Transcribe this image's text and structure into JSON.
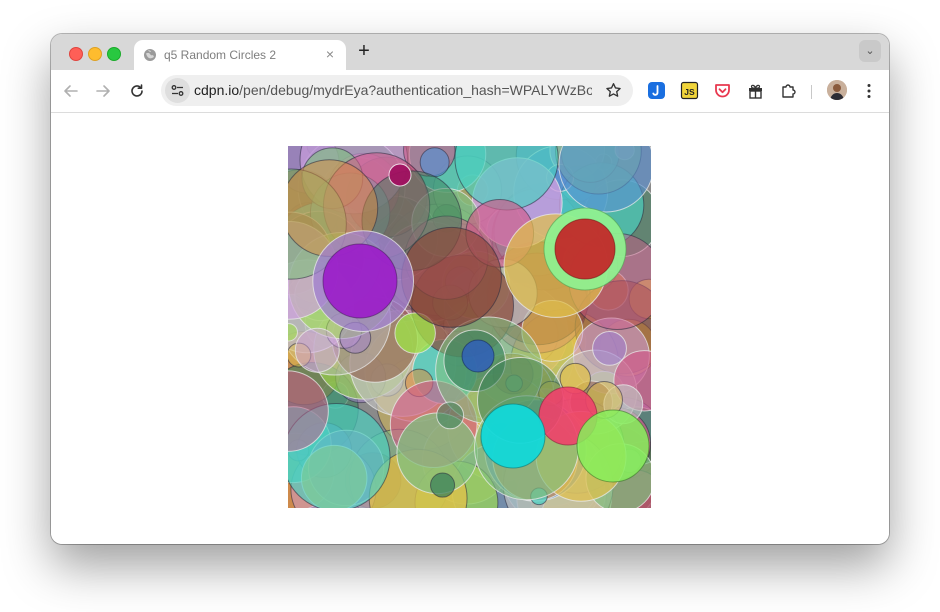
{
  "browser": {
    "tab": {
      "title": "q5 Random Circles 2",
      "close_glyph": "×"
    },
    "new_tab_glyph": "+",
    "tab_search_glyph": "⌄",
    "url": {
      "host": "cdpn.io",
      "path": "/pen/debug/mydrEya?authentication_hash=WPALYWzBo..."
    },
    "extensions": [
      "jsdelivr-icon",
      "js-icon",
      "pocket-icon",
      "gift-icon",
      "puzzle-icon"
    ],
    "colors": {
      "tabstrip": "#d8d8d8",
      "toolbar": "#ffffff",
      "omnibox": "#efefef",
      "jsdelivr": "#1a6fe0",
      "js": "#f0d43a",
      "pocket": "#e8384f"
    }
  },
  "page": {
    "content": "canvas-random-circles",
    "canvas_background": "#8a8a8a",
    "palette": [
      "#7fbf7f",
      "#a07fd0",
      "#e08a3a",
      "#5a8fd0",
      "#d05a8a",
      "#9fe04a",
      "#c0c0c0",
      "#3a7f5a",
      "#e0c04a",
      "#8a4a3a",
      "#4ad0c0",
      "#d0a0e0"
    ],
    "highlights": {
      "purple_circle": "#9b1dc9",
      "red_circle": "#c22a2a",
      "green_ring": "#8ff08f",
      "cyan_circle": "#12d8d8",
      "pink_circle": "#f0406a",
      "light_green_circle": "#86f05a",
      "blue_circle": "#2f5fb8",
      "magenta_dot": "#a01060"
    }
  }
}
